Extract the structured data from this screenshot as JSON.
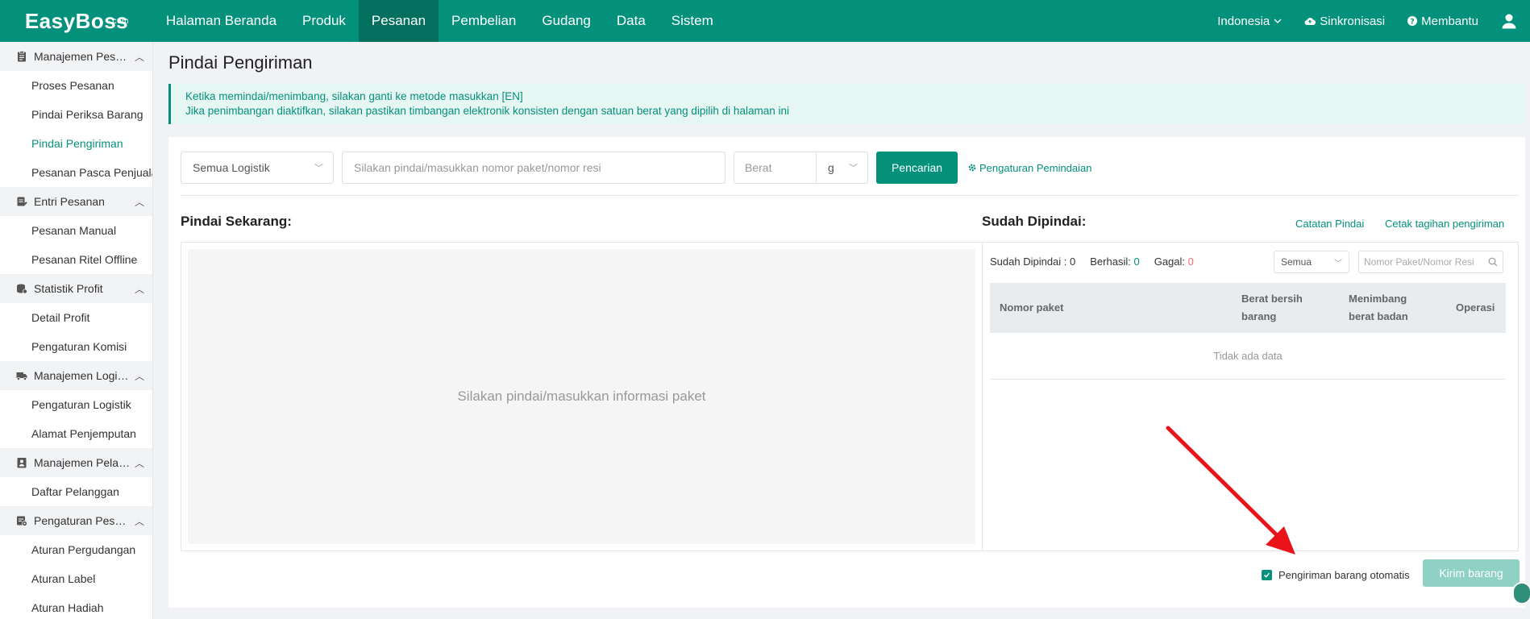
{
  "brand": {
    "logo": "EasyBoss",
    "logo_sup": ".com"
  },
  "nav": [
    {
      "label": "Halaman Beranda"
    },
    {
      "label": "Produk"
    },
    {
      "label": "Pesanan",
      "active": true
    },
    {
      "label": "Pembelian"
    },
    {
      "label": "Gudang"
    },
    {
      "label": "Data"
    },
    {
      "label": "Sistem"
    }
  ],
  "topright": {
    "language": "Indonesia",
    "sync": "Sinkronisasi",
    "help": "Membantu"
  },
  "sidebar": {
    "groups": [
      {
        "label": "Manajemen Pesanan",
        "icon": "clipboard-icon",
        "items": [
          "Proses Pesanan",
          "Pindai Periksa Barang",
          "Pindai Pengiriman",
          "Pesanan Pasca Penjualan"
        ]
      },
      {
        "label": "Entri Pesanan",
        "icon": "order-entry-icon",
        "items": [
          "Pesanan Manual",
          "Pesanan Ritel Offline"
        ]
      },
      {
        "label": "Statistik Profit",
        "icon": "profit-icon",
        "items": [
          "Detail Profit",
          "Pengaturan Komisi"
        ]
      },
      {
        "label": "Manajemen Logistik",
        "icon": "truck-icon",
        "items": [
          "Pengaturan Logistik",
          "Alamat Penjemputan"
        ]
      },
      {
        "label": "Manajemen Pelanggan",
        "icon": "customer-icon",
        "items": [
          "Daftar Pelanggan"
        ]
      },
      {
        "label": "Pengaturan Pesanan",
        "icon": "order-settings-icon",
        "items": [
          "Aturan Pergudangan",
          "Aturan Label",
          "Aturan Hadiah"
        ]
      }
    ],
    "active_item": "Pindai Pengiriman"
  },
  "page": {
    "title": "Pindai Pengiriman",
    "notice_line1": "Ketika memindai/menimbang, silakan ganti ke metode masukkan [EN]",
    "notice_line2": "Jika penimbangan diaktifkan, silakan pastikan timbangan elektronik konsisten dengan satuan berat yang dipilih di halaman ini"
  },
  "controls": {
    "logistics_select": "Semua Logistik",
    "scan_placeholder": "Silakan pindai/masukkan nomor paket/nomor resi",
    "weight_placeholder": "Berat",
    "weight_unit": "g",
    "search_button": "Pencarian",
    "scan_settings": "Pengaturan Pemindaian"
  },
  "scan_now": {
    "title": "Pindai Sekarang:",
    "placeholder": "Silakan pindai/masukkan informasi paket"
  },
  "scanned": {
    "title": "Sudah Dipindai:",
    "scan_log_link": "Catatan Pindai",
    "print_link": "Cetak tagihan pengiriman",
    "stat_scanned_label": "Sudah Dipindai :",
    "stat_scanned_value": "0",
    "stat_success_label": "Berhasil:",
    "stat_success_value": "0",
    "stat_fail_label": "Gagal:",
    "stat_fail_value": "0",
    "filter_select": "Semua",
    "search_placeholder": "Nomor Paket/Nomor Resi",
    "columns": [
      "Nomor paket",
      "Berat bersih barang",
      "Menimbang berat badan",
      "Operasi"
    ],
    "empty_text": "Tidak ada data"
  },
  "footer": {
    "auto_ship_label": "Pengiriman barang otomatis",
    "auto_ship_checked": true,
    "ship_button": "Kirim barang"
  },
  "colors": {
    "primary": "#04917c",
    "primary_dark": "#03705f",
    "fail": "#f56c6c",
    "annotation_arrow": "#e8141a"
  }
}
